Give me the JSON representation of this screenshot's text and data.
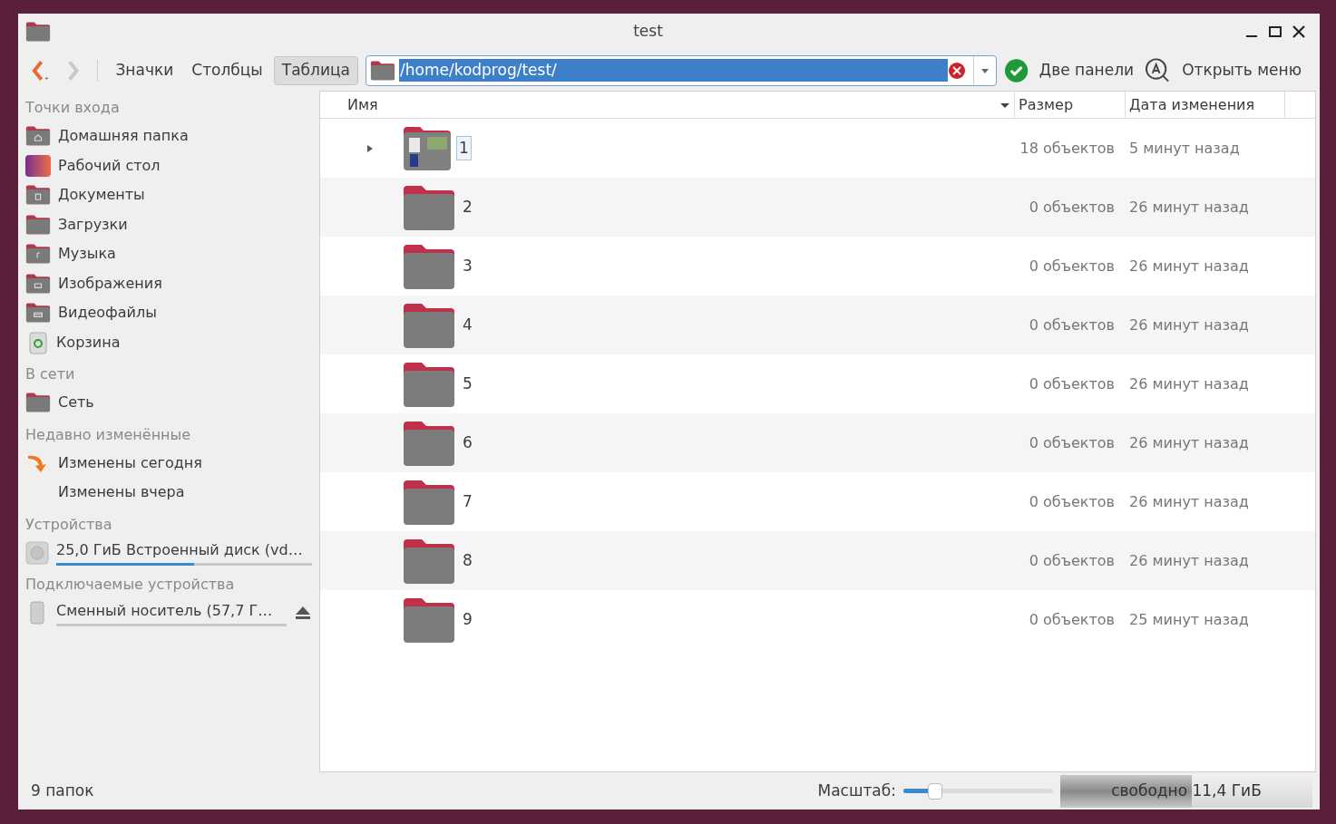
{
  "window": {
    "title": "test"
  },
  "toolbar": {
    "views": [
      {
        "label": "Значки",
        "selected": false
      },
      {
        "label": "Столбцы",
        "selected": false
      },
      {
        "label": "Таблица",
        "selected": true
      }
    ],
    "location": {
      "value": "/home/kodprog/test/"
    },
    "two_panels": "Две панели",
    "open_menu": "Открыть меню"
  },
  "sidebar": [
    {
      "title": "Точки входа",
      "items": [
        {
          "label": "Домашняя папка",
          "kind": "home"
        },
        {
          "label": "Рабочий стол",
          "kind": "desktop"
        },
        {
          "label": "Документы",
          "kind": "documents"
        },
        {
          "label": "Загрузки",
          "kind": "folder"
        },
        {
          "label": "Музыка",
          "kind": "music"
        },
        {
          "label": "Изображения",
          "kind": "pictures"
        },
        {
          "label": "Видеофайлы",
          "kind": "videos"
        },
        {
          "label": "Корзина",
          "kind": "trash"
        }
      ]
    },
    {
      "title": "В сети",
      "items": [
        {
          "label": "Сеть",
          "kind": "folder"
        }
      ]
    },
    {
      "title": "Недавно изменённые",
      "items": [
        {
          "label": "Изменены сегодня",
          "kind": "recent"
        },
        {
          "label": "Изменены вчера",
          "kind": "none"
        }
      ]
    },
    {
      "title": "Устройства",
      "items": [
        {
          "label": "25,0 ГиБ Встроенный диск (vd…",
          "kind": "disk",
          "level": 0.54
        }
      ]
    },
    {
      "title": "Подключаемые устройства",
      "items": [
        {
          "label": "Сменный носитель (57,7 Г…",
          "kind": "usb",
          "eject": true
        }
      ]
    }
  ],
  "table": {
    "columns": [
      {
        "label": "Имя",
        "sorted": true
      },
      {
        "label": "Размер",
        "sorted": false
      },
      {
        "label": "Дата изменения",
        "sorted": false
      }
    ],
    "rows": [
      {
        "name": "1",
        "size": "18 объектов",
        "modified": "5 минут назад",
        "kind": "thumbnails",
        "expandable": true,
        "focused": true
      },
      {
        "name": "2",
        "size": "0 объектов",
        "modified": "26 минут назад",
        "kind": "folder",
        "expandable": false,
        "focused": false
      },
      {
        "name": "3",
        "size": "0 объектов",
        "modified": "26 минут назад",
        "kind": "folder",
        "expandable": false,
        "focused": false
      },
      {
        "name": "4",
        "size": "0 объектов",
        "modified": "26 минут назад",
        "kind": "folder",
        "expandable": false,
        "focused": false
      },
      {
        "name": "5",
        "size": "0 объектов",
        "modified": "26 минут назад",
        "kind": "folder",
        "expandable": false,
        "focused": false
      },
      {
        "name": "6",
        "size": "0 объектов",
        "modified": "26 минут назад",
        "kind": "folder",
        "expandable": false,
        "focused": false
      },
      {
        "name": "7",
        "size": "0 объектов",
        "modified": "26 минут назад",
        "kind": "folder",
        "expandable": false,
        "focused": false
      },
      {
        "name": "8",
        "size": "0 объектов",
        "modified": "26 минут назад",
        "kind": "folder",
        "expandable": false,
        "focused": false
      },
      {
        "name": "9",
        "size": "0 объектов",
        "modified": "25 минут назад",
        "kind": "folder",
        "expandable": false,
        "focused": false
      }
    ]
  },
  "status_bar": {
    "summary": "9 папок",
    "zoom_label": "Масштаб:",
    "zoom": {
      "level": 0.21
    },
    "free_space": {
      "text": "свободно 11,4 ГиБ",
      "level": 0.52
    }
  }
}
